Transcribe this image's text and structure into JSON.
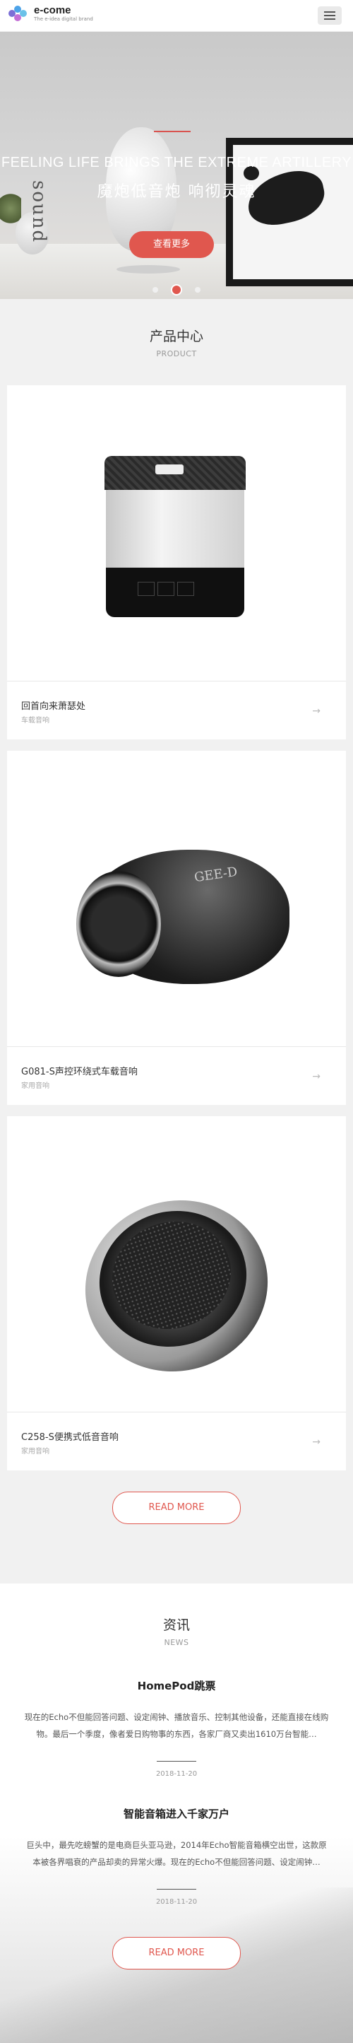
{
  "header": {
    "logo_title": "e-come",
    "logo_sub": "The e-idea digital brand",
    "menu_icon": "hamburger-menu-icon"
  },
  "hero": {
    "title_en": "FEELING LIFE BRINGS THE EXTREME ARTILLERY",
    "title_cn": "魔炮低音炮  响彻灵魂",
    "button": "查看更多",
    "decor_word": "sound",
    "slides_total": 3,
    "active_slide": 2,
    "accent_color": "#e0574e"
  },
  "products": {
    "title": "产品中心",
    "subtitle": "PRODUCT",
    "items": [
      {
        "name": "回首向来萧瑟处",
        "category": "车载音响",
        "arrow": "→"
      },
      {
        "name": "G081-S声控环绕式车载音响",
        "category": "家用音响",
        "arrow": "→",
        "brand_text": "GEE-D"
      },
      {
        "name": "C258-S便携式低音音响",
        "category": "家用音响",
        "arrow": "→"
      }
    ],
    "read_more": "READ MORE"
  },
  "news": {
    "title": "资讯",
    "subtitle": "NEWS",
    "items": [
      {
        "title": "HomePod跳票",
        "desc": "现在的Echo不但能回答问题、设定闹钟、播放音乐、控制其他设备，还能直接在线购物。最后一个季度，像者爱日购物事的东西，各家厂商又卖出1610万台智能…",
        "date": "2018-11-20"
      },
      {
        "title": "智能音箱进入千家万户",
        "desc": "巨头中，最先吃螃蟹的是电商巨头亚马逊，2014年Echo智能音箱横空出世，这款原本被各界唱衰的产品却卖的异常火爆。现在的Echo不但能回答问题、设定闹钟…",
        "date": "2018-11-20"
      }
    ],
    "read_more": "READ MORE"
  }
}
